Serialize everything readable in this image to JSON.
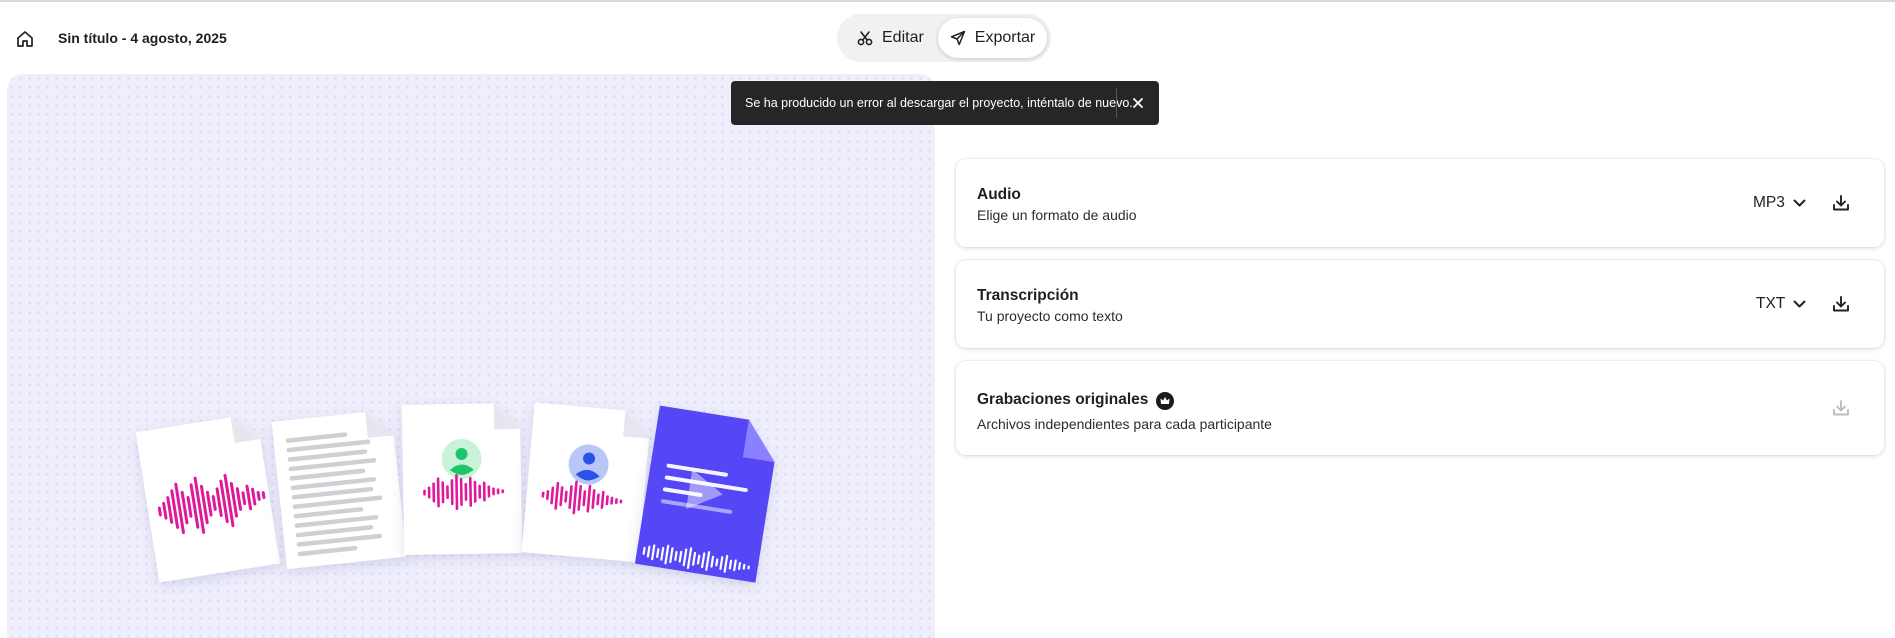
{
  "header": {
    "title": "Sin título - 4 agosto, 2025",
    "modes": {
      "edit_label": "Editar",
      "export_label": "Exportar",
      "active": "Exportar"
    }
  },
  "toast": {
    "message": "Se ha producido un error al descargar el proyecto, inténtalo de nuevo."
  },
  "export_options": [
    {
      "title": "Audio",
      "subtitle": "Elige un formato de audio",
      "format": "MP3",
      "download_enabled": true
    },
    {
      "title": "Transcripción",
      "subtitle": "Tu proyecto como texto",
      "format": "TXT",
      "download_enabled": true
    },
    {
      "title": "Grabaciones originales",
      "subtitle": "Archivos independientes para cada participante",
      "premium": true,
      "download_enabled": false
    }
  ],
  "icons": {
    "home": "home-icon",
    "edit": "scissors-icon",
    "export": "send-icon",
    "close": "close-icon",
    "chevron": "chevron-down-icon",
    "download": "download-icon",
    "premium": "crown-icon"
  },
  "colors": {
    "accent_purple": "#5547f5",
    "waveform_pink": "#e0199a",
    "avatar_green": "#1ec46a",
    "avatar_blue": "#2a52e8",
    "toast_bg": "#262626",
    "panel_bg": "#eeeefc"
  }
}
